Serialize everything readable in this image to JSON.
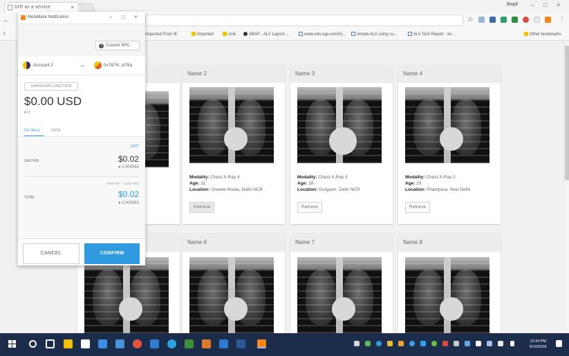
{
  "browser": {
    "tab_title": "DrR as a service",
    "profile_name": "Bopit",
    "bookmarks": [
      {
        "label": "Imported From IE",
        "icon": "folder-icon"
      },
      {
        "label": "Imported",
        "icon": "folder-icon"
      },
      {
        "label": "cmk",
        "icon": "folder-icon"
      },
      {
        "label": "ABAP - ALV Layout ...",
        "icon": "globe-icon"
      },
      {
        "label": "www.sdn.sap.com/irj...",
        "icon": "doc-icon"
      },
      {
        "label": "simple ALV using cu...",
        "icon": "doc-icon"
      },
      {
        "label": "ALV Grid Report - wi...",
        "icon": "doc-icon"
      }
    ],
    "other_bookmarks": "Other bookmarks"
  },
  "metamask": {
    "window_title": "MetaMask Notification",
    "network": "Custom RPC",
    "from_account": "Account 2",
    "to_address": "0x7674...b78a",
    "badge": "UNKNOWN FUNCTION",
    "amount": "$0.00 USD",
    "eth_amount": "♦ 0",
    "tabs": [
      "DETAILS",
      "DATA"
    ],
    "edit_label": "EDIT",
    "gas_fee_label": "GAS FEE",
    "gas_fee_usd": "$0.02",
    "gas_fee_eth": "♦ 0.000063",
    "amount_gas_label": "AMOUNT + GAS FEE",
    "total_label": "TOTAL",
    "total_usd": "$0.02",
    "total_eth": "♦ 0.000063",
    "cancel_label": "CANCEL",
    "confirm_label": "CONFIRM"
  },
  "cards": [
    {
      "name": "Name 2",
      "modality": "Chest X-Ray 4",
      "age": "32",
      "location": "Greater Noida, Delhi NCR",
      "button": "Retrieve"
    },
    {
      "name": "Name 3",
      "modality": "Chest X-Ray 3",
      "age": "28",
      "location": "Gurgaon, Delhi NCR",
      "button": "Retrieve"
    },
    {
      "name": "Name 4",
      "modality": "Chest X-Ray 2",
      "age": "29",
      "location": "Phampura, New Delhi",
      "button": "Retrieve"
    },
    {
      "name": "Name 6"
    },
    {
      "name": "Name 7"
    },
    {
      "name": "Name 8"
    }
  ],
  "field_labels": {
    "modality": "Modality:",
    "age": "Age:",
    "location": "Location:"
  },
  "taskbar": {
    "time": "12:34 PM",
    "date": "8/10/2018"
  },
  "colors": {
    "accent_blue": "#2f9ae0",
    "taskbar": "#1c2d4c",
    "metamask_orange": "#f6851b"
  }
}
